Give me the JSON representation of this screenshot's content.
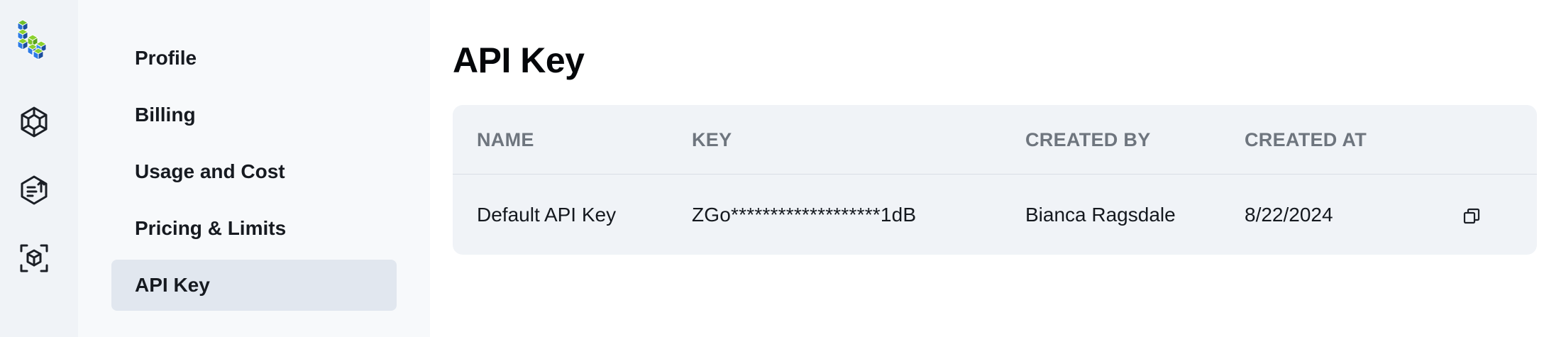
{
  "rail": {
    "icons": [
      "logo-icon",
      "hexagon-icon",
      "file-upload-icon",
      "scan-cube-icon"
    ]
  },
  "settings_nav": {
    "items": [
      {
        "label": "Profile",
        "active": false
      },
      {
        "label": "Billing",
        "active": false
      },
      {
        "label": "Usage and Cost",
        "active": false
      },
      {
        "label": "Pricing & Limits",
        "active": false
      },
      {
        "label": "API Key",
        "active": true
      }
    ]
  },
  "main": {
    "title": "API Key",
    "table": {
      "columns": [
        "NAME",
        "KEY",
        "CREATED BY",
        "CREATED AT"
      ],
      "rows": [
        {
          "name": "Default API Key",
          "key": "ZGo*******************1dB",
          "created_by": "Bianca Ragsdale",
          "created_at": "8/22/2024",
          "action_icon": "copy-icon"
        }
      ]
    }
  },
  "colors": {
    "rail_bg": "#f0f3f7",
    "nav_bg": "#f7f9fb",
    "active_item_bg": "#e1e7ef",
    "card_bg": "#f0f3f7",
    "header_text": "#6e757e",
    "logo_blue": "#2e7be6",
    "logo_green": "#8bd12e"
  }
}
